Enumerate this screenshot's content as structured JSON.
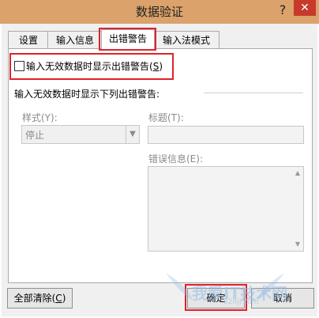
{
  "dialog": {
    "title": "数据验证",
    "help": "?",
    "close": "✕"
  },
  "tabs": [
    {
      "label": "设置"
    },
    {
      "label": "输入信息"
    },
    {
      "label": "出错警告"
    },
    {
      "label": "输入法模式"
    }
  ],
  "error_alert": {
    "show_checkbox_label": "输入无效数据时显示出错警告(",
    "show_checkbox_hotkey": "S",
    "show_checkbox_suffix": ")",
    "show_checkbox_checked": false,
    "group_label": "输入无效数据时显示下列出错警告:",
    "style_label": "样式(Y):",
    "style_value": "停止",
    "title_label": "标题(T):",
    "title_value": "",
    "message_label": "错误信息(E):",
    "message_value": ""
  },
  "buttons": {
    "clear_all_label": "全部清除(",
    "clear_all_hotkey": "C",
    "clear_all_suffix": ")",
    "ok_label": "确定",
    "cancel_label": "取消"
  },
  "watermark": {
    "text": "我爱IT技术网",
    "sub": "52itji.com"
  },
  "colors": {
    "titlebar": "#dba26b",
    "close_button": "#c6392b",
    "highlight_box": "#e0222b"
  }
}
